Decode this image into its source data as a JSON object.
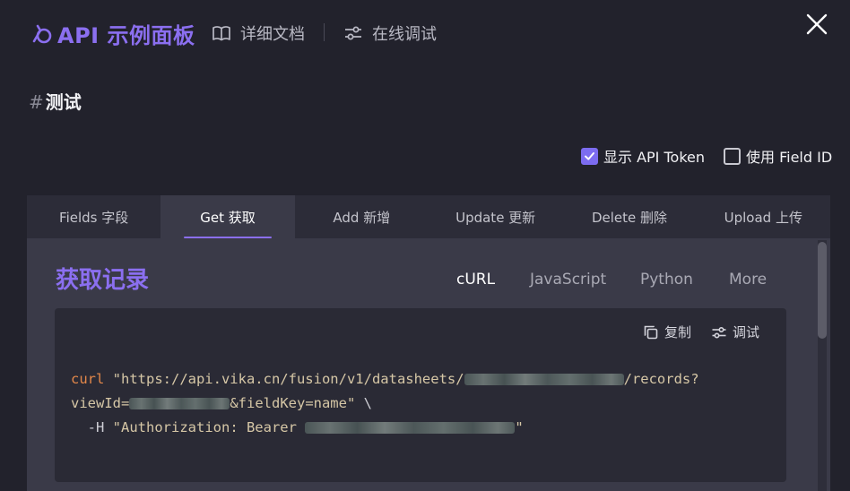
{
  "header": {
    "title": "API 示例面板",
    "docs_label": "详细文档",
    "debug_label": "在线调试"
  },
  "page": {
    "hash": "#",
    "title": "测试"
  },
  "options": {
    "show_token_label": "显示 API Token",
    "show_token_checked": true,
    "use_field_id_label": "使用 Field ID",
    "use_field_id_checked": false
  },
  "tabs": [
    {
      "label": "Fields 字段",
      "active": false
    },
    {
      "label": "Get 获取",
      "active": true
    },
    {
      "label": "Add 新增",
      "active": false
    },
    {
      "label": "Update 更新",
      "active": false
    },
    {
      "label": "Delete 删除",
      "active": false
    },
    {
      "label": "Upload 上传",
      "active": false
    }
  ],
  "section": {
    "title": "获取记录",
    "languages": [
      "cURL",
      "JavaScript",
      "Python",
      "More"
    ],
    "active_language": "cURL"
  },
  "code_box": {
    "copy_label": "复制",
    "debug_label": "调试",
    "line1_cmd": "curl",
    "line1_str_a": " \"https://api.vika.cn/fusion/v1/datasheets/",
    "line1_str_b": "/records?",
    "line2_a": "viewId=",
    "line2_b": "&fieldKey=name\"",
    "line2_c": " \\",
    "line3_a": "  -H ",
    "line3_b": "\"Authorization: Bearer ",
    "line3_c": "\""
  },
  "colors": {
    "accent": "#8b6ff0",
    "background": "#22222c",
    "panel": "#3a3a48",
    "code_bg": "#2a2a35",
    "keyword": "#e4884a"
  }
}
